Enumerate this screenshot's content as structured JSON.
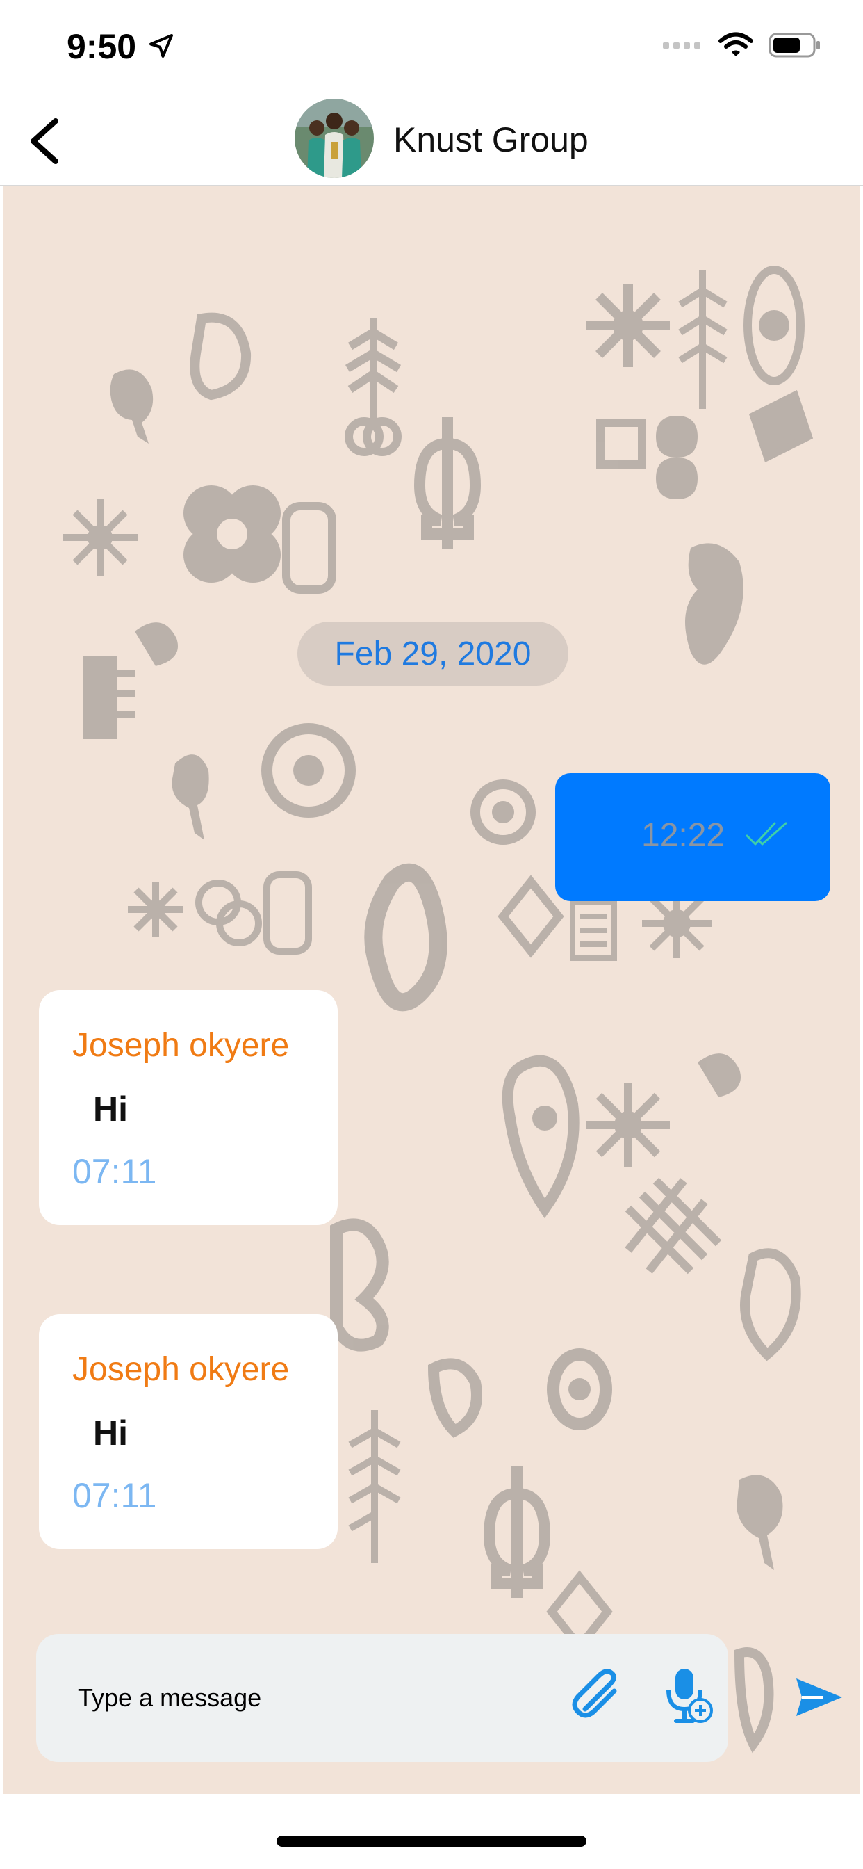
{
  "status_bar": {
    "time": "9:50"
  },
  "header": {
    "title": "Knust Group",
    "back_icon": "chevron-left-icon",
    "avatar": "group-avatar"
  },
  "chat": {
    "date_separator": "Feb 29, 2020",
    "outgoing": [
      {
        "time": "12:22",
        "status_icon": "double-check-icon"
      }
    ],
    "incoming": [
      {
        "sender": "Joseph okyere",
        "text": "Hi",
        "time": "07:11"
      },
      {
        "sender": "Joseph okyere",
        "text": "Hi",
        "time": "07:11"
      }
    ]
  },
  "composer": {
    "placeholder": "Type a message",
    "value": "",
    "attach_icon": "paperclip-icon",
    "mic_icon": "microphone-plus-icon",
    "send_icon": "send-icon"
  },
  "colors": {
    "accent": "#007aff",
    "chat_background": "#f2e3d8",
    "sender_name": "#f07b14",
    "date_text": "#1f7ae0"
  }
}
